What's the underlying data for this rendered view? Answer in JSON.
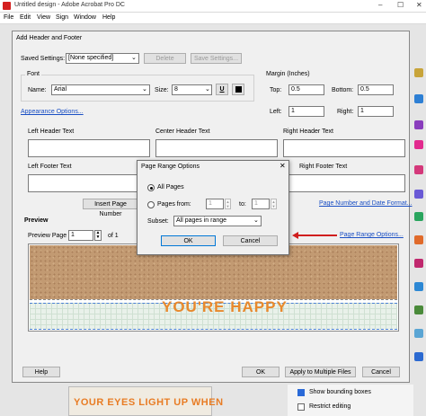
{
  "app": {
    "title": "Untitled design - Adobe Acrobat Pro DC",
    "controls": [
      "–",
      "☐",
      "✕"
    ],
    "menu": [
      "File",
      "Edit",
      "View",
      "Sign",
      "Window",
      "Help"
    ]
  },
  "right_panel": {
    "options": [
      {
        "label": "Show bounding boxes",
        "checked": true
      },
      {
        "label": "Restrict editing",
        "checked": false
      }
    ]
  },
  "canvas": {
    "text": "YOUR EYES LIGHT UP WHEN"
  },
  "dialog": {
    "title": "Add Header and Footer",
    "saved_settings_label": "Saved Settings:",
    "saved_settings_value": "[None specified]",
    "delete_label": "Delete",
    "save_settings_label": "Save Settings...",
    "font": {
      "group_label": "Font",
      "name_label": "Name:",
      "name_value": "Arial",
      "size_label": "Size:",
      "size_value": "8",
      "underline_glyph": "U",
      "color": "#000000"
    },
    "margin": {
      "group_label": "Margin (Inches)",
      "top_label": "Top:",
      "top_value": "0.5",
      "bottom_label": "Bottom:",
      "bottom_value": "0.5",
      "left_label": "Left:",
      "left_value": "1",
      "right_label": "Right:",
      "right_value": "1"
    },
    "appearance_link": "Appearance Options...",
    "headers": {
      "left": "Left Header Text",
      "center": "Center Header Text",
      "right": "Right Header Text"
    },
    "footers": {
      "left": "Left Footer Text",
      "center": "",
      "right": "Right Footer Text"
    },
    "insert_page_number": "Insert Page Number",
    "page_number_format_link": "Page Number and Date Format...",
    "page_range_link": "Page Range Options...",
    "preview": {
      "label": "Preview",
      "page_label": "Preview Page",
      "page_value": "1",
      "of_label": "of 1",
      "text": "YOU'RE HAPPY"
    },
    "help_label": "Help",
    "ok_label": "OK",
    "apply_label": "Apply to Multiple Files",
    "cancel_label": "Cancel"
  },
  "page_range": {
    "title": "Page Range Options",
    "all_pages_label": "All Pages",
    "all_pages_selected": true,
    "pages_from_label": "Pages from:",
    "from_value": "1",
    "to_label": "to:",
    "to_value": "1",
    "subset_label": "Subset:",
    "subset_value": "All pages in range",
    "ok_label": "OK",
    "cancel_label": "Cancel"
  },
  "colors": {
    "annotation_arrow": "#d01e1e",
    "link": "#1a4fc4",
    "preview_text": "#e8892d"
  }
}
